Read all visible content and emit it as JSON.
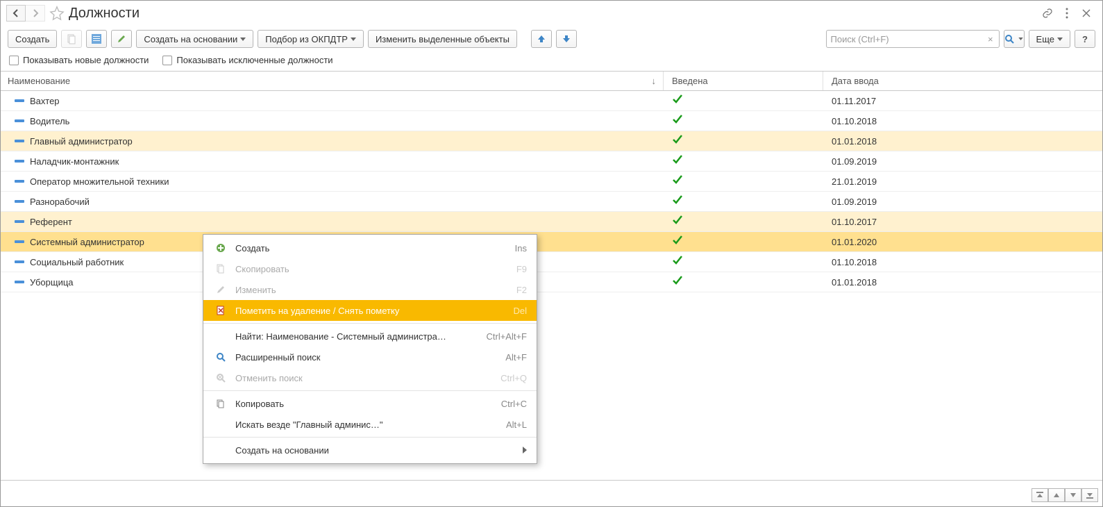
{
  "page": {
    "title": "Должности"
  },
  "toolbar": {
    "create": "Создать",
    "create_based": "Создать на основании",
    "select_okpdtr": "Подбор из ОКПДТР",
    "edit_selected": "Изменить выделенные объекты",
    "more": "Еще"
  },
  "search": {
    "placeholder": "Поиск (Ctrl+F)"
  },
  "filters": {
    "show_new": "Показывать новые должности",
    "show_excluded": "Показывать исключенные должности"
  },
  "columns": {
    "name": "Наименование",
    "introduced": "Введена",
    "date": "Дата ввода"
  },
  "rows": [
    {
      "name": "Вахтер",
      "introduced": true,
      "date": "01.11.2017",
      "hl": false
    },
    {
      "name": "Водитель",
      "introduced": true,
      "date": "01.10.2018",
      "hl": false
    },
    {
      "name": "Главный администратор",
      "introduced": true,
      "date": "01.01.2018",
      "hl": true
    },
    {
      "name": "Наладчик-монтажник",
      "introduced": true,
      "date": "01.09.2019",
      "hl": false
    },
    {
      "name": "Оператор множительной техники",
      "introduced": true,
      "date": "21.01.2019",
      "hl": false
    },
    {
      "name": "Разнорабочий",
      "introduced": true,
      "date": "01.09.2019",
      "hl": false
    },
    {
      "name": "Референт",
      "introduced": true,
      "date": "01.10.2017",
      "hl": true
    },
    {
      "name": "Системный администратор",
      "introduced": true,
      "date": "01.01.2020",
      "hl": true,
      "sel": true
    },
    {
      "name": "Социальный работник",
      "introduced": true,
      "date": "01.10.2018",
      "hl": false
    },
    {
      "name": "Уборщица",
      "introduced": true,
      "date": "01.01.2018",
      "hl": false
    }
  ],
  "context_menu": [
    {
      "icon": "plus",
      "label": "Создать",
      "shortcut": "Ins",
      "disabled": false
    },
    {
      "icon": "copy-doc",
      "label": "Скопировать",
      "shortcut": "F9",
      "disabled": true
    },
    {
      "icon": "pencil",
      "label": "Изменить",
      "shortcut": "F2",
      "disabled": true
    },
    {
      "icon": "del",
      "label": "Пометить на удаление / Снять пометку",
      "shortcut": "Del",
      "hover": true
    },
    {
      "sep": true
    },
    {
      "icon": "",
      "label": "Найти: Наименование - Системный администра…",
      "shortcut": "Ctrl+Alt+F"
    },
    {
      "icon": "search",
      "label": "Расширенный поиск",
      "shortcut": "Alt+F"
    },
    {
      "icon": "search-x",
      "label": "Отменить поиск",
      "shortcut": "Ctrl+Q",
      "disabled": true
    },
    {
      "sep": true
    },
    {
      "icon": "copy",
      "label": "Копировать",
      "shortcut": "Ctrl+C"
    },
    {
      "icon": "",
      "label": "Искать везде \"Главный админис…\"",
      "shortcut": "Alt+L"
    },
    {
      "sep": true
    },
    {
      "icon": "",
      "label": "Создать на основании",
      "submenu": true
    }
  ]
}
